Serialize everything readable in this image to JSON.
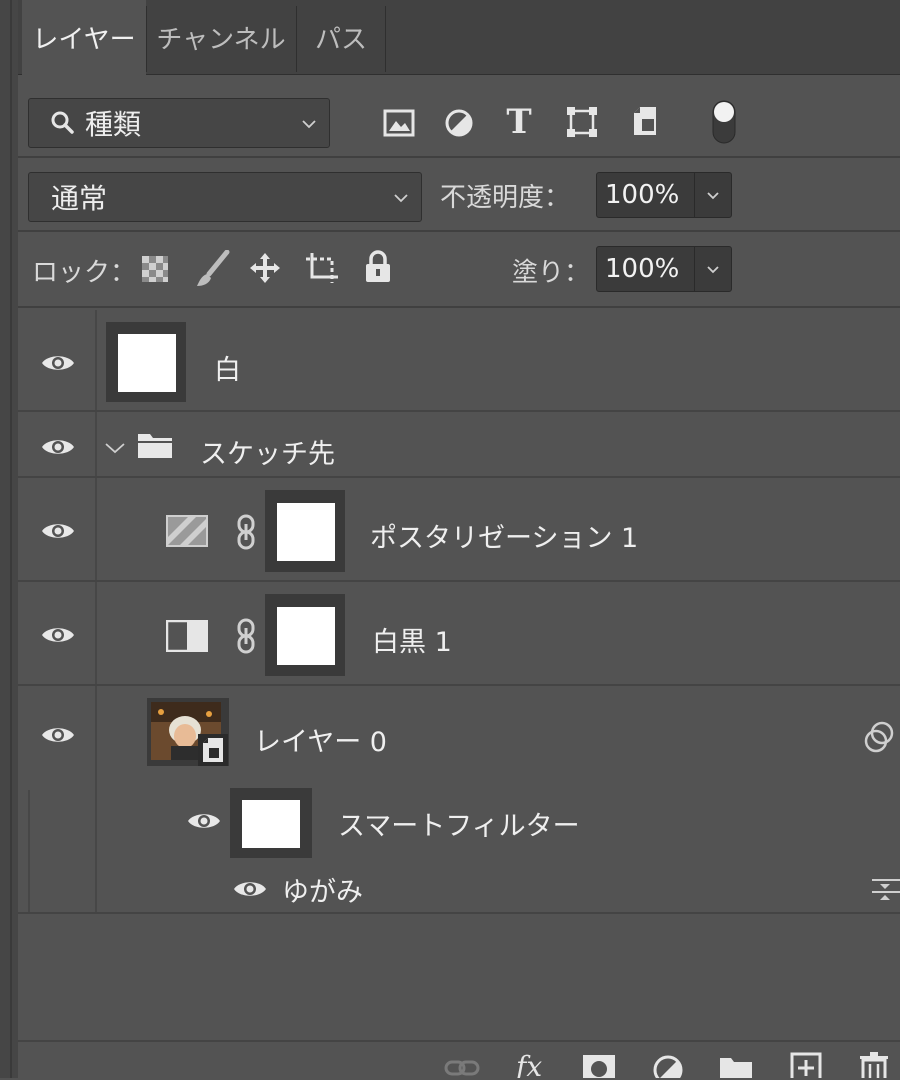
{
  "tabs": [
    {
      "label": "レイヤー",
      "active": true
    },
    {
      "label": "チャンネル",
      "active": false
    },
    {
      "label": "パス",
      "active": false
    }
  ],
  "filter": {
    "kind_label": "種類"
  },
  "blend": {
    "mode": "通常",
    "opacity_label": "不透明度：",
    "opacity_value": "100%"
  },
  "lock": {
    "label": "ロック：",
    "fill_label": "塗り：",
    "fill_value": "100%"
  },
  "layers": {
    "white": {
      "name": "白"
    },
    "group": {
      "name": "スケッチ先"
    },
    "posterize": {
      "name": "ポスタリゼーション 1"
    },
    "bw": {
      "name": "白黒 1"
    },
    "layer0": {
      "name": "レイヤー 0"
    },
    "smart_filter": {
      "name": "スマートフィルター"
    },
    "liquify": {
      "name": "ゆがみ"
    }
  },
  "icons": {
    "filter_pixel": "image-icon",
    "filter_adjustment": "adjustment-icon",
    "filter_type": "type-icon",
    "filter_shape": "shape-icon",
    "filter_smart": "smart-object-icon",
    "filter_toggle": "filter-toggle-icon"
  },
  "colors": {
    "panel": "#535353",
    "tabbar": "#424242",
    "field": "#3b3b3b"
  }
}
